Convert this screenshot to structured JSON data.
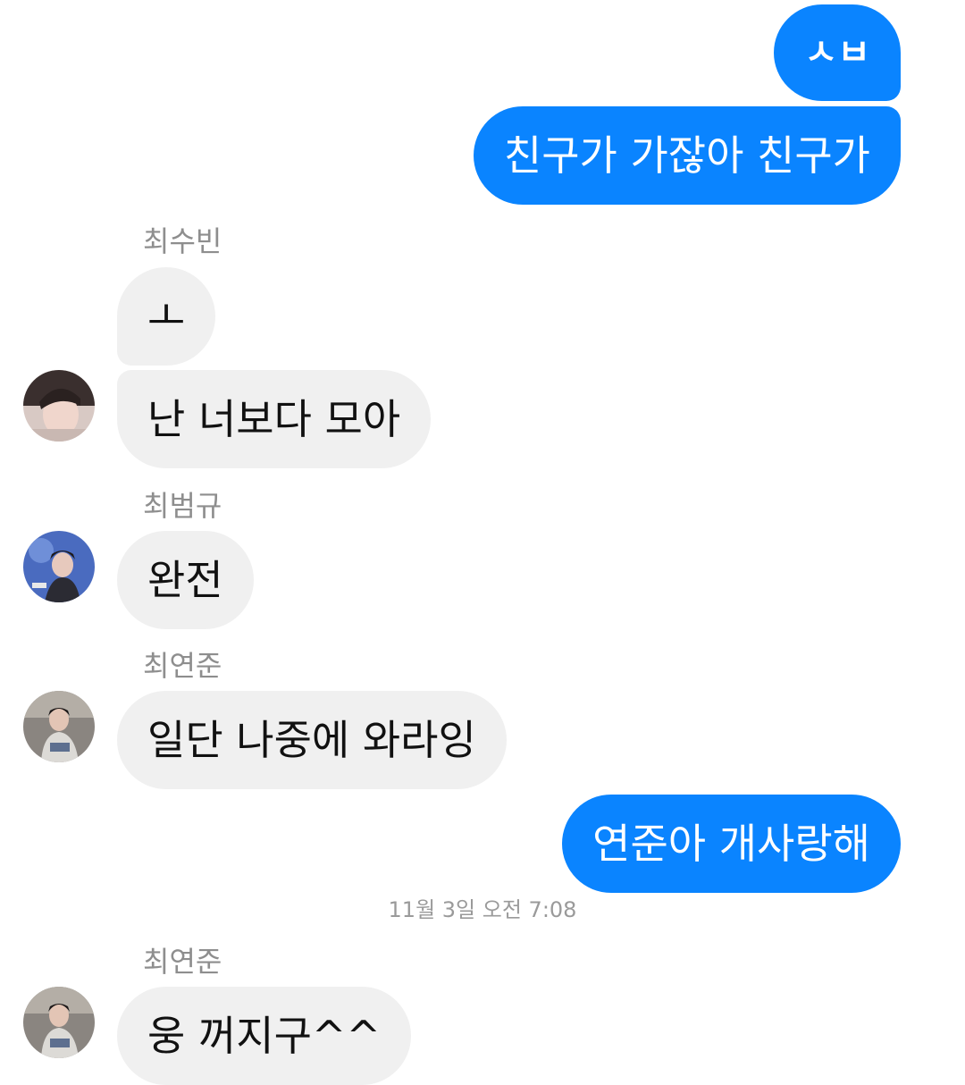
{
  "messages": {
    "m1": {
      "text": "ㅅㅂ"
    },
    "m2": {
      "text": "친구가 가잖아 친구가"
    },
    "m3": {
      "sender": "최수빈",
      "text": "ㅗ"
    },
    "m4": {
      "text": "난 너보다 모아"
    },
    "m5": {
      "sender": "최범규",
      "text": "완전"
    },
    "m6": {
      "sender": "최연준",
      "text": "일단 나중에 와라잉"
    },
    "m7": {
      "text": "연준아 개사랑해"
    },
    "m8": {
      "sender": "최연준",
      "text": "웅 꺼지구^^"
    }
  },
  "timestamp": "11월 3일 오전 7:08",
  "colors": {
    "outgoing_bubble": "#0a84ff",
    "incoming_bubble": "#f0f0f0",
    "sender_name": "#8e8e8e"
  }
}
